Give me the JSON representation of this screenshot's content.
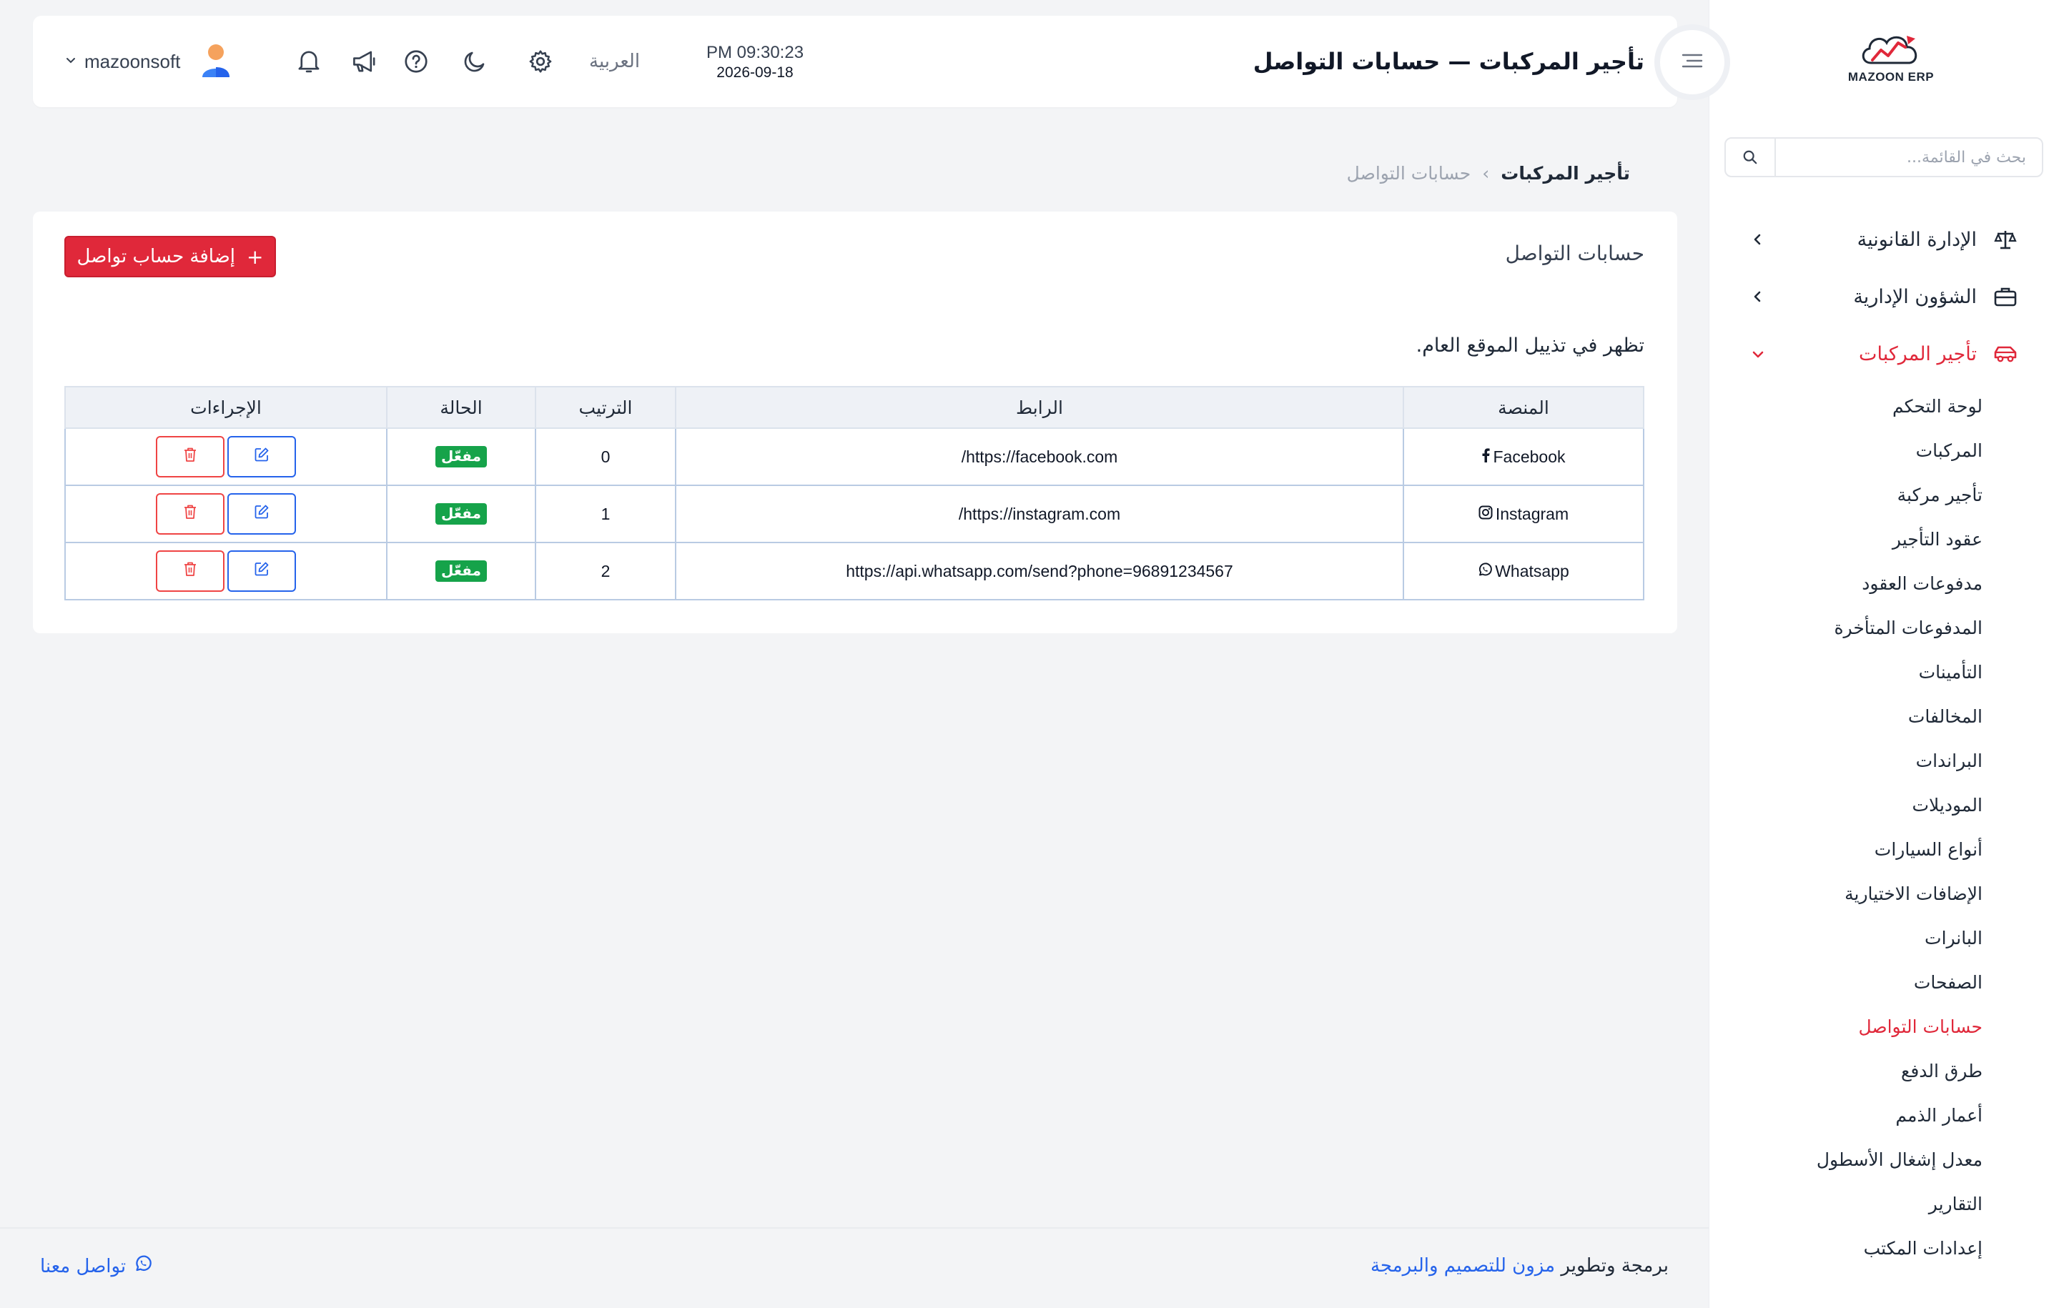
{
  "app": {
    "logo_text": "MAZOON ERP"
  },
  "sidebar": {
    "search_placeholder": "بحث في القائمة...",
    "groups": [
      {
        "label": "الإدارة القانونية",
        "icon": "scale-icon"
      },
      {
        "label": "الشؤون الإدارية",
        "icon": "briefcase-icon"
      },
      {
        "label": "تأجير المركبات",
        "icon": "car-icon",
        "expanded": true
      }
    ],
    "sub_items": [
      {
        "label": "لوحة التحكم"
      },
      {
        "label": "المركبات"
      },
      {
        "label": "تأجير مركبة"
      },
      {
        "label": "عقود التأجير"
      },
      {
        "label": "مدفوعات العقود"
      },
      {
        "label": "المدفوعات المتأخرة"
      },
      {
        "label": "التأمينات"
      },
      {
        "label": "المخالفات"
      },
      {
        "label": "البراندات"
      },
      {
        "label": "الموديلات"
      },
      {
        "label": "أنواع السيارات"
      },
      {
        "label": "الإضافات الاختيارية"
      },
      {
        "label": "البانرات"
      },
      {
        "label": "الصفحات"
      },
      {
        "label": "حسابات التواصل",
        "active": true
      },
      {
        "label": "طرق الدفع"
      },
      {
        "label": "أعمار الذمم"
      },
      {
        "label": "معدل إشغال الأسطول"
      },
      {
        "label": "التقارير"
      },
      {
        "label": "إعدادات المكتب"
      }
    ]
  },
  "topbar": {
    "title": "تأجير المركبات — حسابات التواصل",
    "time": "PM 09:30:23",
    "date": "2026-09-18",
    "language": "العربية",
    "username": "mazoonsoft"
  },
  "breadcrumb": {
    "root": "تأجير المركبات",
    "separator": "›",
    "current": "حسابات التواصل"
  },
  "card": {
    "title": "حسابات التواصل",
    "add_button": "إضافة حساب تواصل",
    "description": "تظهر في تذييل الموقع العام."
  },
  "table": {
    "headers": {
      "platform": "المنصة",
      "link": "الرابط",
      "order": "الترتيب",
      "status": "الحالة",
      "actions": "الإجراءات"
    },
    "rows": [
      {
        "platform": "Facebook",
        "icon": "facebook-icon",
        "link": "https://facebook.com/",
        "order": "0",
        "status": "مفعّل"
      },
      {
        "platform": "Instagram",
        "icon": "instagram-icon",
        "link": "https://instagram.com/",
        "order": "1",
        "status": "مفعّل"
      },
      {
        "platform": "Whatsapp",
        "icon": "whatsapp-icon",
        "link": "https://api.whatsapp.com/send?phone=96891234567",
        "order": "2",
        "status": "مفعّل"
      }
    ]
  },
  "footer": {
    "credit_prefix": "برمجة وتطوير",
    "credit_brand": "مزون للتصميم والبرمجة",
    "contact": "تواصل معنا"
  },
  "colors": {
    "accent": "#e0283a",
    "link": "#2563eb",
    "success": "#16a34a"
  }
}
